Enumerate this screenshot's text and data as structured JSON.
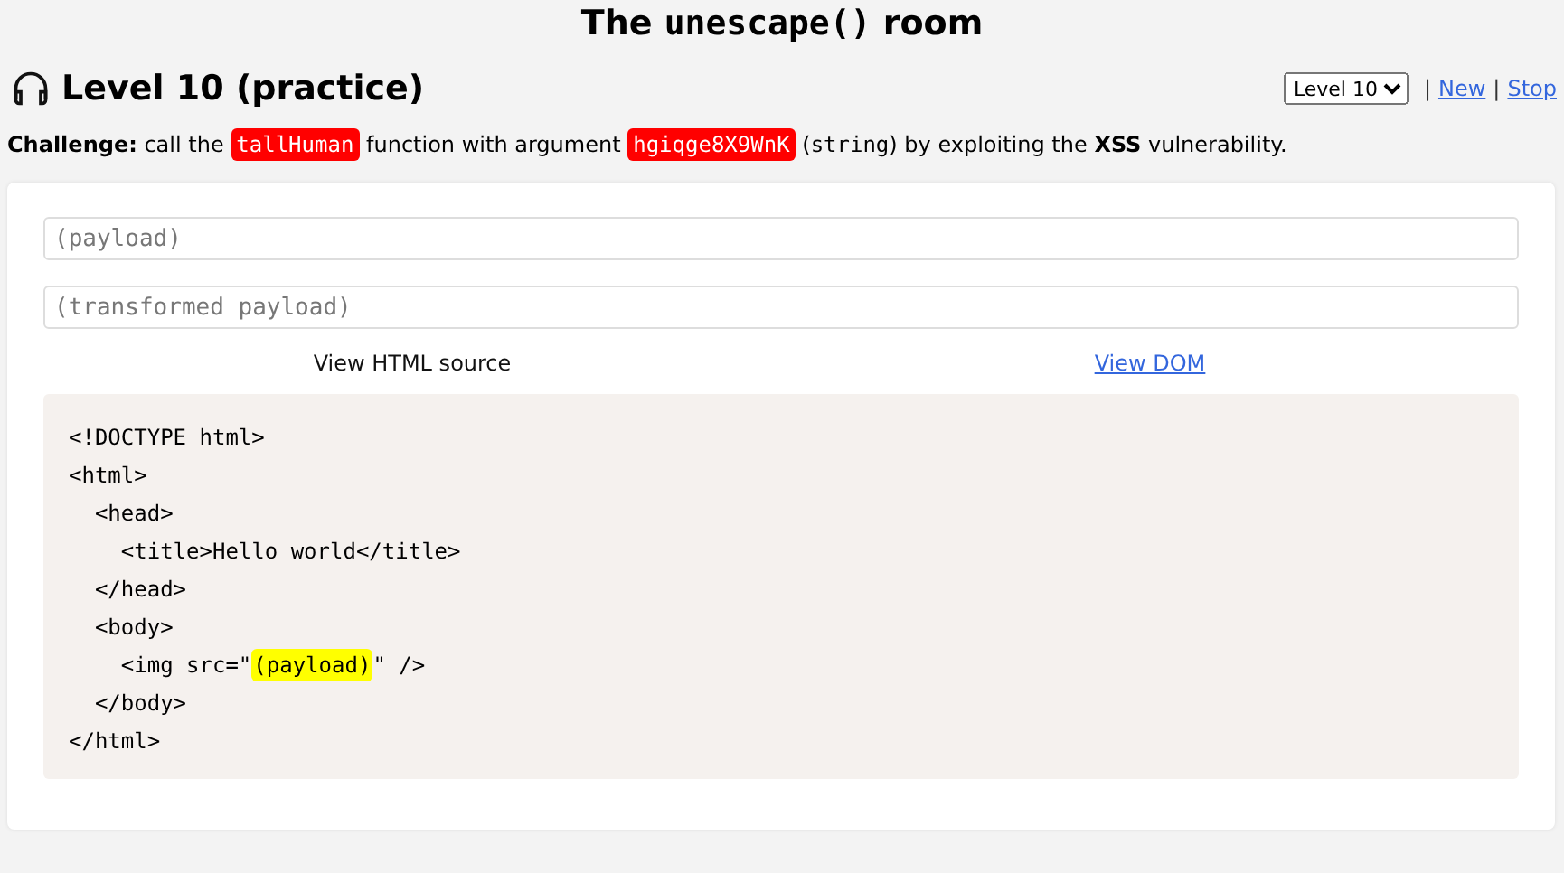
{
  "title": [
    {
      "text": "The ",
      "kind": "text"
    },
    {
      "text": "unescape()",
      "kind": "code"
    },
    {
      "text": " room",
      "kind": "text"
    }
  ],
  "level": {
    "heading": "Level 10 (practice)",
    "select": "Level 10",
    "links": [
      {
        "label": "New"
      },
      {
        "label": "Stop"
      }
    ],
    "separator": "|"
  },
  "challenge": [
    {
      "text": "Challenge:",
      "kind": "bold"
    },
    {
      "text": " call the ",
      "kind": "text"
    },
    {
      "text": "tallHuman",
      "kind": "badge"
    },
    {
      "text": " function with argument ",
      "kind": "text"
    },
    {
      "text": "hgiqge8X9WnK",
      "kind": "badge"
    },
    {
      "text": " (",
      "kind": "text"
    },
    {
      "text": "string",
      "kind": "code"
    },
    {
      "text": ") by exploiting the ",
      "kind": "text"
    },
    {
      "text": "XSS",
      "kind": "bold"
    },
    {
      "text": " vulnerability.",
      "kind": "text"
    }
  ],
  "fields": [
    {
      "placeholder": "(payload)"
    },
    {
      "placeholder": "(transformed payload)"
    }
  ],
  "tabs": [
    {
      "label": "View HTML source",
      "selected": true
    },
    {
      "label": "View DOM",
      "selected": false
    }
  ],
  "code_lines": [
    [
      {
        "text": "<!DOCTYPE html>",
        "kind": "text"
      }
    ],
    [
      {
        "text": "<html>",
        "kind": "text"
      }
    ],
    [
      {
        "text": "  <head>",
        "kind": "text"
      }
    ],
    [
      {
        "text": "    <title>Hello world</title>",
        "kind": "text"
      }
    ],
    [
      {
        "text": "  </head>",
        "kind": "text"
      }
    ],
    [
      {
        "text": "  <body>",
        "kind": "text"
      }
    ],
    [
      {
        "text": "    <img src=\"",
        "kind": "text"
      },
      {
        "text": "(payload)",
        "kind": "highlight"
      },
      {
        "text": "\" />",
        "kind": "text"
      }
    ],
    [
      {
        "text": "  </body>",
        "kind": "text"
      }
    ],
    [
      {
        "text": "</html>",
        "kind": "text"
      }
    ]
  ]
}
